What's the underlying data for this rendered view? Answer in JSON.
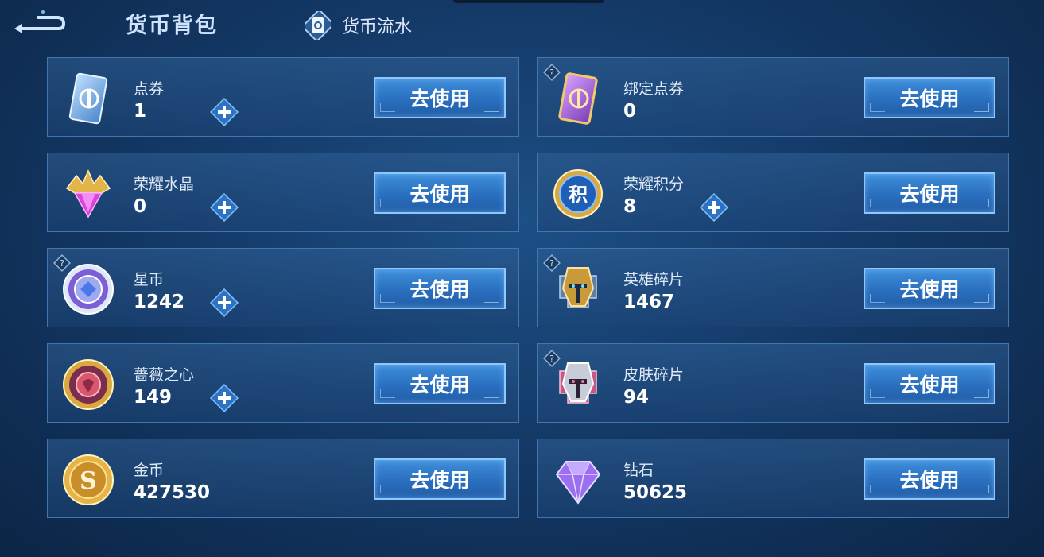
{
  "header": {
    "title": "货币背包",
    "flow_label": "货币流水"
  },
  "button_label": "去使用",
  "colors": {
    "accent": "#3f8fdc",
    "card_border": "#3f77b3",
    "background": "#143a68"
  },
  "currencies": [
    {
      "name": "点券",
      "value": "1",
      "icon": "ticket-blue-icon",
      "plus": true,
      "help": false
    },
    {
      "name": "绑定点券",
      "value": "0",
      "icon": "ticket-purple-icon",
      "plus": false,
      "help": true
    },
    {
      "name": "荣耀水晶",
      "value": "0",
      "icon": "glory-crystal-icon",
      "plus": true,
      "help": false
    },
    {
      "name": "荣耀积分",
      "value": "8",
      "icon": "glory-points-icon",
      "plus": true,
      "help": false
    },
    {
      "name": "星币",
      "value": "1242",
      "icon": "star-coin-icon",
      "plus": true,
      "help": true
    },
    {
      "name": "英雄碎片",
      "value": "1467",
      "icon": "hero-fragment-icon",
      "plus": false,
      "help": true
    },
    {
      "name": "蔷薇之心",
      "value": "149",
      "icon": "rose-heart-icon",
      "plus": true,
      "help": false
    },
    {
      "name": "皮肤碎片",
      "value": "94",
      "icon": "skin-fragment-icon",
      "plus": false,
      "help": true
    },
    {
      "name": "金币",
      "value": "427530",
      "icon": "gold-coin-icon",
      "plus": false,
      "help": false
    },
    {
      "name": "钻石",
      "value": "50625",
      "icon": "diamond-icon",
      "plus": false,
      "help": false
    }
  ],
  "glory_points_icon_text": "积"
}
